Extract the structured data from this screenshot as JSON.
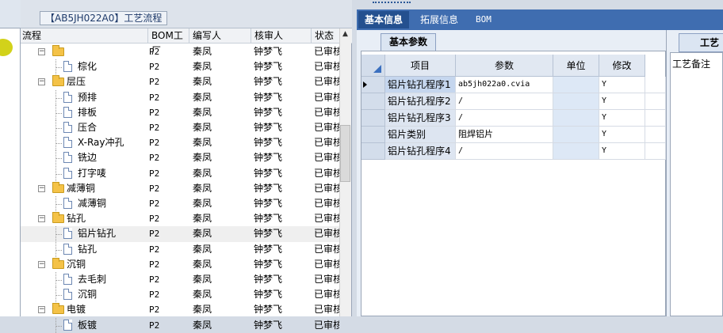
{
  "tree_panel": {
    "title": "【AB5JH022A0】工艺流程",
    "columns": [
      "流程",
      "BOM工厂",
      "编写人",
      "核审人",
      "状态"
    ],
    "rows": [
      {
        "name": "",
        "type": "folder-partial",
        "bom": "P2",
        "writer": "秦凤",
        "reviewer": "钟梦飞",
        "status": "已审核"
      },
      {
        "name": "棕化",
        "type": "doc",
        "bom": "P2",
        "writer": "秦凤",
        "reviewer": "钟梦飞",
        "status": "已审核"
      },
      {
        "name": "层压",
        "type": "folder",
        "bom": "P2",
        "writer": "秦凤",
        "reviewer": "钟梦飞",
        "status": "已审核"
      },
      {
        "name": "预排",
        "type": "doc",
        "bom": "P2",
        "writer": "秦凤",
        "reviewer": "钟梦飞",
        "status": "已审核"
      },
      {
        "name": "排板",
        "type": "doc",
        "bom": "P2",
        "writer": "秦凤",
        "reviewer": "钟梦飞",
        "status": "已审核"
      },
      {
        "name": "压合",
        "type": "doc",
        "bom": "P2",
        "writer": "秦凤",
        "reviewer": "钟梦飞",
        "status": "已审核"
      },
      {
        "name": "X-Ray冲孔",
        "type": "doc",
        "bom": "P2",
        "writer": "秦凤",
        "reviewer": "钟梦飞",
        "status": "已审核"
      },
      {
        "name": "铣边",
        "type": "doc",
        "bom": "P2",
        "writer": "秦凤",
        "reviewer": "钟梦飞",
        "status": "已审核"
      },
      {
        "name": "打字唛",
        "type": "doc",
        "bom": "P2",
        "writer": "秦凤",
        "reviewer": "钟梦飞",
        "status": "已审核"
      },
      {
        "name": "减薄铜",
        "type": "folder",
        "bom": "P2",
        "writer": "秦凤",
        "reviewer": "钟梦飞",
        "status": "已审核"
      },
      {
        "name": "减薄铜",
        "type": "doc",
        "bom": "P2",
        "writer": "秦凤",
        "reviewer": "钟梦飞",
        "status": "已审核"
      },
      {
        "name": "钻孔",
        "type": "folder",
        "bom": "P2",
        "writer": "秦凤",
        "reviewer": "钟梦飞",
        "status": "已审核"
      },
      {
        "name": "铝片钻孔",
        "type": "doc",
        "bom": "P2",
        "writer": "秦凤",
        "reviewer": "钟梦飞",
        "status": "已审核",
        "selected": true
      },
      {
        "name": "钻孔",
        "type": "doc",
        "bom": "P2",
        "writer": "秦凤",
        "reviewer": "钟梦飞",
        "status": "已审核"
      },
      {
        "name": "沉铜",
        "type": "folder",
        "bom": "P2",
        "writer": "秦凤",
        "reviewer": "钟梦飞",
        "status": "已审核"
      },
      {
        "name": "去毛刺",
        "type": "doc",
        "bom": "P2",
        "writer": "秦凤",
        "reviewer": "钟梦飞",
        "status": "已审核"
      },
      {
        "name": "沉铜",
        "type": "doc",
        "bom": "P2",
        "writer": "秦凤",
        "reviewer": "钟梦飞",
        "status": "已审核"
      },
      {
        "name": "电镀",
        "type": "folder",
        "bom": "P2",
        "writer": "秦凤",
        "reviewer": "钟梦飞",
        "status": "已审核"
      },
      {
        "name": "板镀",
        "type": "doc",
        "bom": "P2",
        "writer": "秦凤",
        "reviewer": "钟梦飞",
        "status": "已审核"
      }
    ]
  },
  "tabs": [
    "基本信息",
    "拓展信息",
    "BOM"
  ],
  "sub_tab": "基本参数",
  "params_grid": {
    "headers": [
      "项目",
      "参数",
      "单位",
      "修改"
    ],
    "rows": [
      {
        "item": "铝片钻孔程序1",
        "param": "ab5jh022a0.cvia",
        "unit": "",
        "modified": "Y"
      },
      {
        "item": "铝片钻孔程序2",
        "param": "/",
        "unit": "",
        "modified": "Y"
      },
      {
        "item": "铝片钻孔程序3",
        "param": "/",
        "unit": "",
        "modified": "Y"
      },
      {
        "item": "铝片类别",
        "param": "阻焊铝片",
        "unit": "",
        "modified": "Y"
      },
      {
        "item": "铝片钻孔程序4",
        "param": "/",
        "unit": "",
        "modified": "Y"
      }
    ]
  },
  "far_right": {
    "tab_label": "工艺备",
    "field_label": "工艺备注"
  }
}
